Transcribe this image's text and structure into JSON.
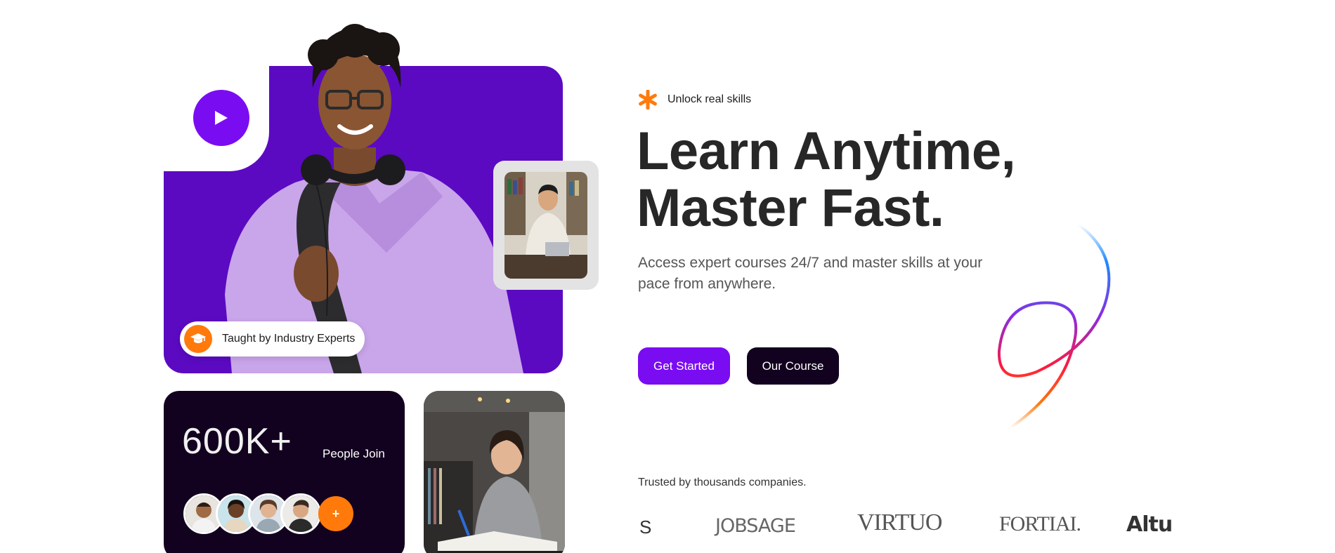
{
  "hero": {
    "eyebrow": "Unlock real skills",
    "headline_line1": "Learn Anytime,",
    "headline_line2": "Master Fast.",
    "subtext": "Access expert courses 24/7 and master skills at your pace from anywhere.",
    "primary_cta": "Get Started",
    "secondary_cta": "Our Course"
  },
  "visual": {
    "expert_badge": "Taught by Industry Experts",
    "stats_number": "600K+",
    "stats_label": "People Join",
    "avatars_plus": "+"
  },
  "trusted": {
    "label": "Trusted by thousands companies.",
    "logos": [
      "S",
      "JOBSAGE",
      "VIRTUO",
      "FORTIAI.",
      "Altu"
    ]
  },
  "colors": {
    "brand_purple": "#7a0cf2",
    "hero_card": "#5b0ac2",
    "dark": "#12021f",
    "accent_orange": "#ff7a0b"
  },
  "icons": {
    "play": "play-icon",
    "graduation": "graduation-cap-icon",
    "asterisk": "asterisk-icon"
  }
}
